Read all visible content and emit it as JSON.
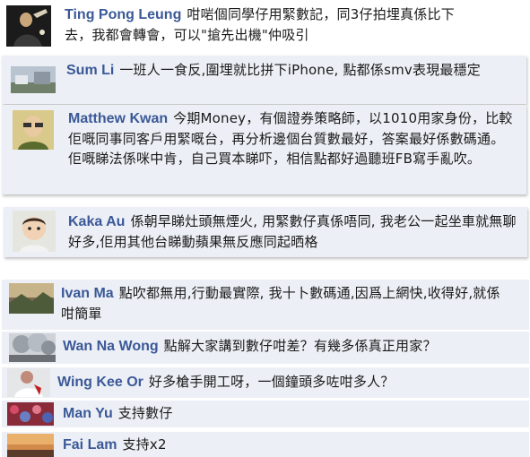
{
  "comments": [
    {
      "name": "Ting Pong Leung",
      "message": "咁啱個同學仔用緊數記，同3仔拍埋真係比下去，我都會轉會，可以\"搶先出機\"仲吸引",
      "avatar_icon": "person-dark-icon"
    },
    {
      "name": "Sum Li",
      "message": "一班人一食反,圍埋就比拼下iPhone, 點都係smv表現最穩定",
      "avatar_icon": "landscape-icon"
    },
    {
      "name": "Matthew Kwan",
      "message": "今期Money，有個證券策略師，以1010用家身份，比較佢嘅同事同客戶用緊嘅台，再分析邊個台質數最好，答案最好係數碼通。佢嘅睇法係咪中肯，自己買本睇吓，相信點都好過聽班FB寫手亂吹。",
      "avatar_icon": "person-icon"
    },
    {
      "name": "Kaka Au",
      "message": "係朝早睇灶頭無煙火, 用緊數仔真係唔同, 我老公一起坐車就無聊好多,佢用其他台睇動蘋果無反應同起晒格",
      "avatar_icon": "baby-icon"
    },
    {
      "name": "Ivan Ma",
      "message": "點吹都無用,行動最實際, 我十卜數碼通,因爲上網快,收得好,就係咁簡單",
      "avatar_icon": "scenery-icon"
    },
    {
      "name": "Wan Na Wong",
      "message": "點解大家講到數仔咁差？有幾多係真正用家？",
      "avatar_icon": "tree-icon"
    },
    {
      "name": "Wing Kee Or",
      "message": "好多槍手開工呀，一個鐘頭多咗咁多人？",
      "avatar_icon": "person-white-icon"
    },
    {
      "name": "Man Yu",
      "message": "支持數仔",
      "avatar_icon": "flowers-icon"
    },
    {
      "name": "Fai Lam",
      "message": "支持x2",
      "avatar_icon": "sunset-icon"
    }
  ]
}
